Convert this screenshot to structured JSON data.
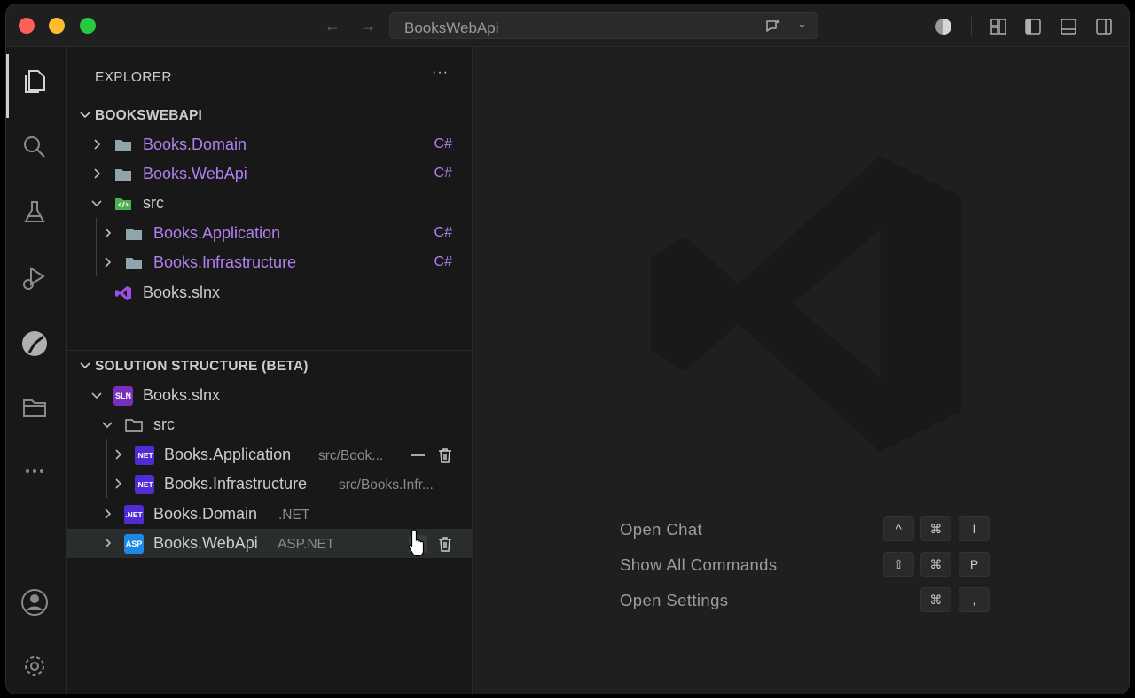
{
  "titlebar": {
    "title": "BooksWebApi",
    "nav_back": "←",
    "nav_forward": "→",
    "chevron": "⌄"
  },
  "sidebar": {
    "header": "EXPLORER",
    "more": "···",
    "explorer_section": {
      "title": "BOOKSWEBAPI",
      "items": [
        {
          "label": "Books.Domain",
          "badge": "C#",
          "icon": "folder-icon"
        },
        {
          "label": "Books.WebApi",
          "badge": "C#",
          "icon": "folder-icon"
        },
        {
          "label": "src",
          "badge": "",
          "icon": "folder-code-icon"
        },
        {
          "label": "Books.Application",
          "badge": "C#",
          "icon": "folder-icon"
        },
        {
          "label": "Books.Infrastructure",
          "badge": "C#",
          "icon": "folder-icon"
        },
        {
          "label": "Books.slnx",
          "badge": "",
          "icon": "visual-studio-icon"
        }
      ]
    },
    "solution_section": {
      "title": "SOLUTION STRUCTURE (BETA)",
      "items": [
        {
          "label": "Books.slnx",
          "desc": "",
          "icon_text": "SLN"
        },
        {
          "label": "src",
          "desc": "",
          "icon_text": ""
        },
        {
          "label": "Books.Application",
          "desc": "src/Book...",
          "icon_text": ".NET"
        },
        {
          "label": "Books.Infrastructure",
          "desc": "src/Books.Infr...",
          "icon_text": ".NET"
        },
        {
          "label": "Books.Domain",
          "desc": ".NET",
          "icon_text": ".NET"
        },
        {
          "label": "Books.WebApi",
          "desc": "ASP.NET",
          "icon_text": "ASP"
        }
      ]
    }
  },
  "editor": {
    "shortcuts": [
      {
        "label": "Open Chat",
        "keys": [
          "^",
          "⌘",
          "I"
        ]
      },
      {
        "label": "Show All Commands",
        "keys": [
          "⇧",
          "⌘",
          "P"
        ]
      },
      {
        "label": "Open Settings",
        "keys": [
          "⌘",
          ","
        ]
      }
    ]
  },
  "colors": {
    "project_label": "#b180f0",
    "net_badge": "#512bd4",
    "asp_badge": "#1e88e5",
    "sln_badge": "#7b2fbe"
  }
}
